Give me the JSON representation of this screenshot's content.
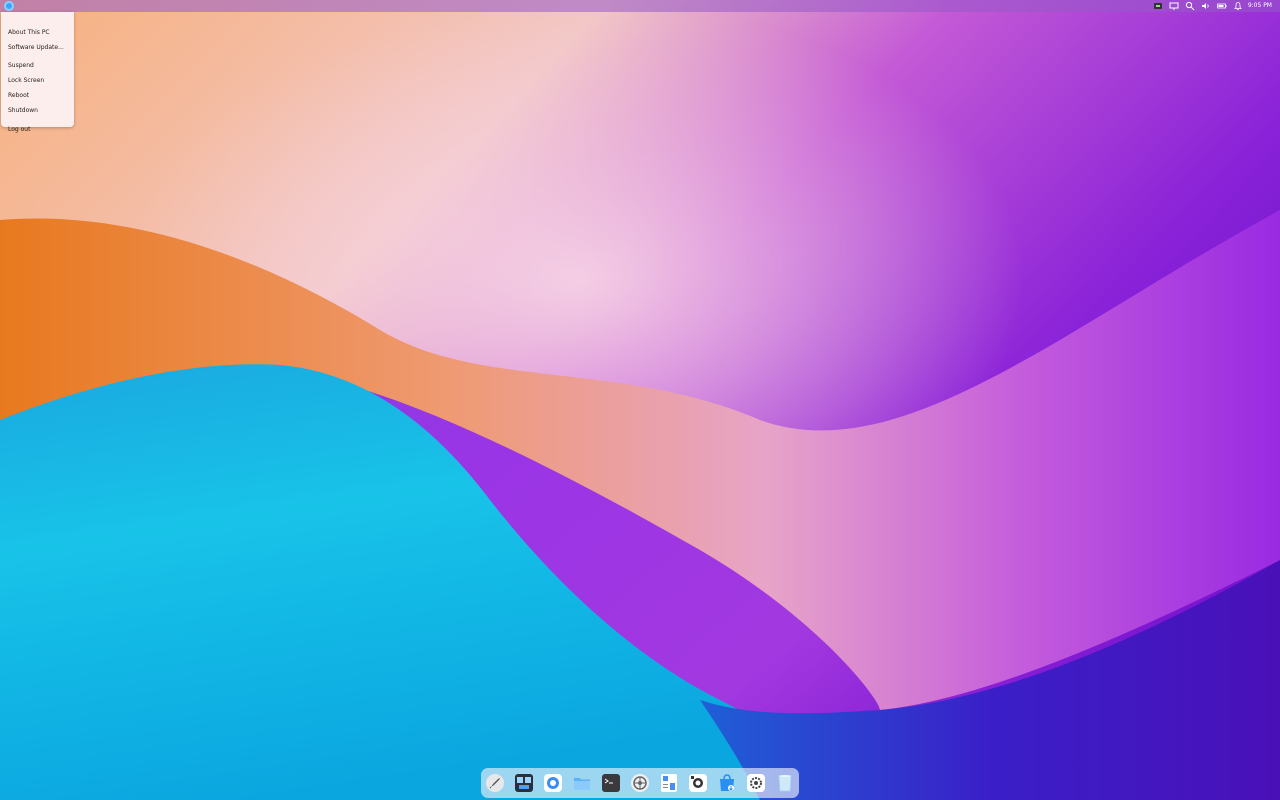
{
  "desktop": {
    "wallpaper": "abstract purple, orange and blue waves",
    "colors": {
      "purple": "#9b2fe0",
      "orange": "#f08a3a",
      "cyan": "#15c3ea",
      "deep_purple": "#5a0fc0",
      "peach": "#f6c8b8"
    }
  },
  "topbar": {
    "menu_button_icon": "deepin-logo-icon",
    "tray_icons": [
      "screen-record-icon",
      "display-icon",
      "search-icon",
      "volume-icon",
      "battery-icon",
      "notification-icon"
    ],
    "clock": "9:05 PM"
  },
  "power_menu": {
    "items": [
      {
        "label": "About This PC"
      },
      {
        "label": "Software Update..."
      },
      {
        "label": "Suspend"
      },
      {
        "label": "Lock Screen"
      },
      {
        "label": "Reboot"
      },
      {
        "label": "Shutdown"
      },
      {
        "label": "Log out"
      }
    ]
  },
  "dock": {
    "apps": [
      {
        "name": "launcher",
        "icon": "rocket-icon"
      },
      {
        "name": "multitasking",
        "icon": "workspace-icon"
      },
      {
        "name": "browser",
        "icon": "browser-icon"
      },
      {
        "name": "files",
        "icon": "folder-icon"
      },
      {
        "name": "terminal",
        "icon": "terminal-icon"
      },
      {
        "name": "system-monitor",
        "icon": "monitor-wheel-icon"
      },
      {
        "name": "calculator",
        "icon": "calculator-icon"
      },
      {
        "name": "screenshot",
        "icon": "camera-icon"
      },
      {
        "name": "app-store",
        "icon": "store-bag-icon"
      },
      {
        "name": "settings",
        "icon": "gear-icon"
      },
      {
        "name": "trash",
        "icon": "trash-icon"
      }
    ]
  }
}
